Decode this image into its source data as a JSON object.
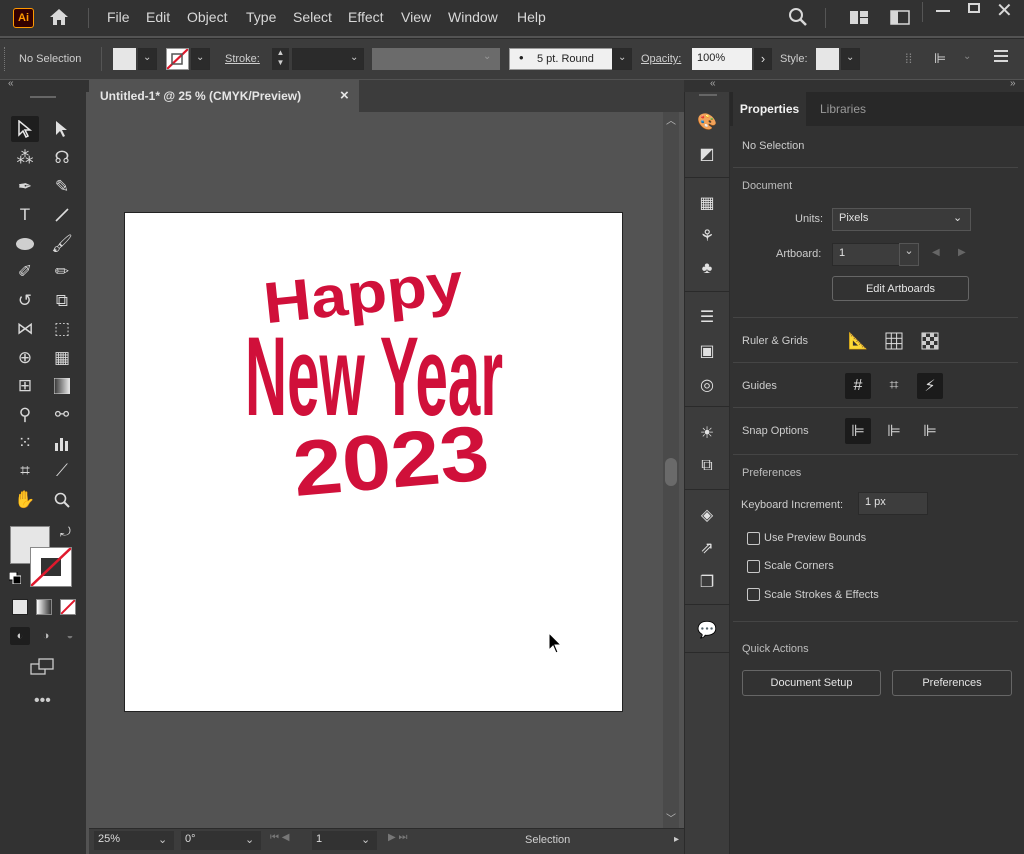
{
  "app": {
    "logo_text": "Ai"
  },
  "menu": [
    "File",
    "Edit",
    "Object",
    "Type",
    "Select",
    "Effect",
    "View",
    "Window",
    "Help"
  ],
  "control": {
    "selection_label": "No Selection",
    "stroke_label": "Stroke:",
    "brush_label": "5 pt. Round",
    "opacity_label": "Opacity:",
    "opacity_value": "100%",
    "style_label": "Style:"
  },
  "document": {
    "tab_title": "Untitled-1* @ 25 % (CMYK/Preview)",
    "close_glyph": "×",
    "art_lines": [
      "Happy",
      "New Year",
      "2023"
    ],
    "art_color": "#d0103a"
  },
  "statusbar": {
    "zoom": "25%",
    "rotation": "0°",
    "artboard": "1",
    "mode": "Selection"
  },
  "properties": {
    "tabs": [
      "Properties",
      "Libraries"
    ],
    "selection": "No Selection",
    "document_header": "Document",
    "units_label": "Units:",
    "units_value": "Pixels",
    "artboard_label": "Artboard:",
    "artboard_value": "1",
    "edit_artboards": "Edit Artboards",
    "ruler_grids": "Ruler & Grids",
    "guides": "Guides",
    "snap_options": "Snap Options",
    "preferences_header": "Preferences",
    "keyboard_increment_label": "Keyboard Increment:",
    "keyboard_increment_value": "1 px",
    "checkboxes": [
      "Use Preview Bounds",
      "Scale Corners",
      "Scale Strokes & Effects"
    ],
    "quick_actions": "Quick Actions",
    "document_setup": "Document Setup",
    "preferences_button": "Preferences"
  }
}
